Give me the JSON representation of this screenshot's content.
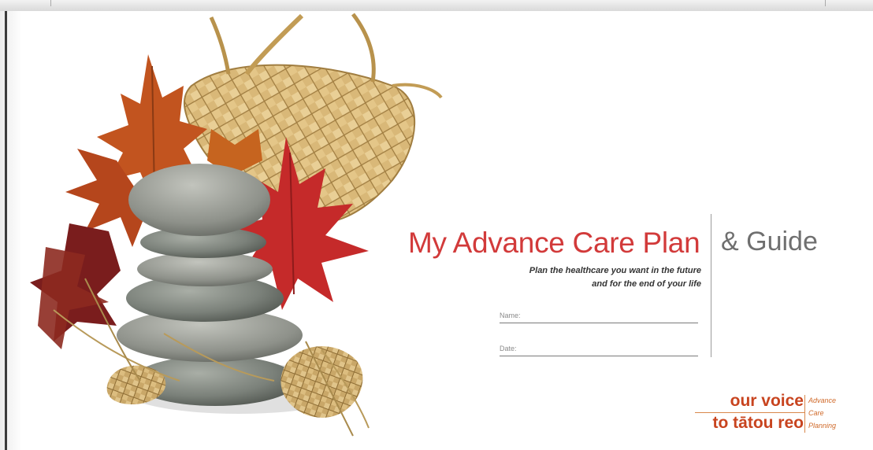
{
  "document": {
    "title": "My Advance Care Plan",
    "title_suffix": "& Guide",
    "tagline_line1": "Plan the healthcare you want in the future",
    "tagline_line2": "and for the end of your life",
    "fields": [
      {
        "label": "Name:"
      },
      {
        "label": "Date:"
      }
    ]
  },
  "logo": {
    "line1": "our voice",
    "line2": "to tātou reo",
    "side_line1": "Advance",
    "side_line2": "Care",
    "side_line3": "Planning"
  },
  "colors": {
    "title": "#d23a3a",
    "suffix": "#6f6f6f",
    "logo": "#c8441f"
  }
}
